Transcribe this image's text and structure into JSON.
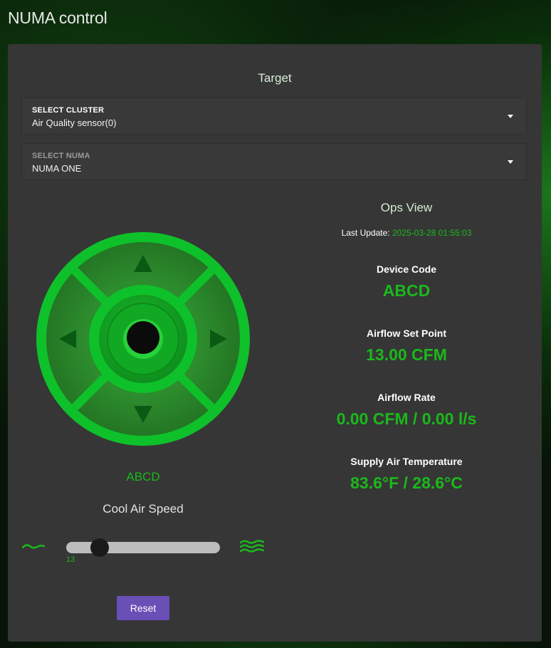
{
  "app": {
    "title": "NUMA control"
  },
  "target": {
    "heading": "Target",
    "cluster_select": {
      "label": "SELECT CLUSTER",
      "value": "Air Quality sensor(0)"
    },
    "numa_select": {
      "label": "SELECT NUMA",
      "value": "NUMA ONE"
    }
  },
  "control": {
    "device_code": "ABCD",
    "speed_title": "Cool Air Speed",
    "speed_value": "13",
    "speed_fraction": 0.13,
    "reset_label": "Reset"
  },
  "ops": {
    "title": "Ops View",
    "last_update_label": "Last Update:",
    "last_update_value": "2025-03-28 01:55:03",
    "metrics": [
      {
        "label": "Device Code",
        "value": "ABCD"
      },
      {
        "label": "Airflow Set Point",
        "value": "13.00 CFM"
      },
      {
        "label": "Airflow Rate",
        "value": "0.00 CFM / 0.00 l/s"
      },
      {
        "label": "Supply Air Temperature",
        "value": "83.6°F / 28.6°C"
      }
    ]
  },
  "colors": {
    "accent_green": "#1bb81b",
    "panel": "#363636",
    "button": "#6a4fb6"
  },
  "icons": [
    "caret-down-icon",
    "arrow-up-icon",
    "arrow-down-icon",
    "arrow-left-icon",
    "arrow-right-icon",
    "slow-wave-icon",
    "fast-wave-icon"
  ]
}
